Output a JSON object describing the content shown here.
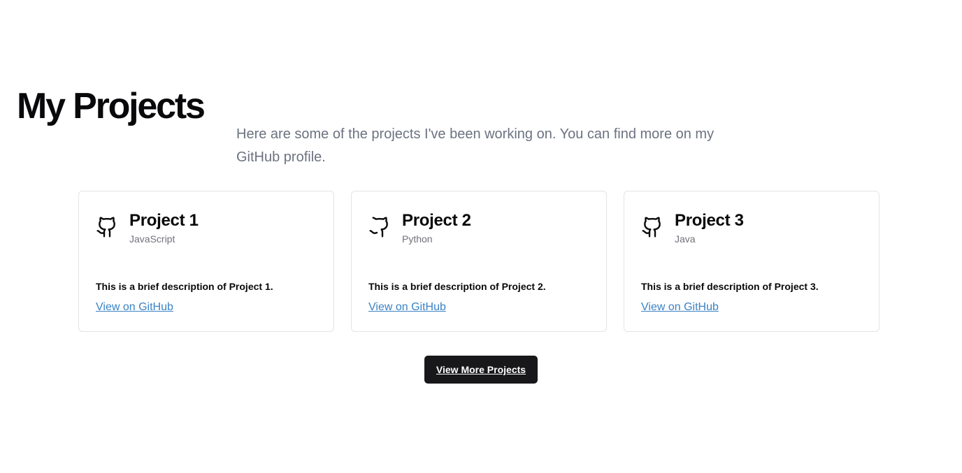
{
  "header": {
    "title": "My Projects",
    "intro": "Here are some of the projects I've been working on. You can find more on my GitHub profile."
  },
  "projects": [
    {
      "icon": "github-icon",
      "title": "Project 1",
      "language": "JavaScript",
      "description": "This is a brief description of Project 1.",
      "link_label": "View on GitHub"
    },
    {
      "icon": "github-icon",
      "title": "Project 2",
      "language": "Python",
      "description": "This is a brief description of Project 2.",
      "link_label": "View on GitHub"
    },
    {
      "icon": "github-icon",
      "title": "Project 3",
      "language": "Java",
      "description": "This is a brief description of Project 3.",
      "link_label": "View on GitHub"
    }
  ],
  "actions": {
    "more_label": "View More Projects"
  },
  "colors": {
    "link": "#3b82c4",
    "button_bg": "#18181b",
    "muted_text": "#6b7280",
    "card_border": "#e4e4e7"
  }
}
